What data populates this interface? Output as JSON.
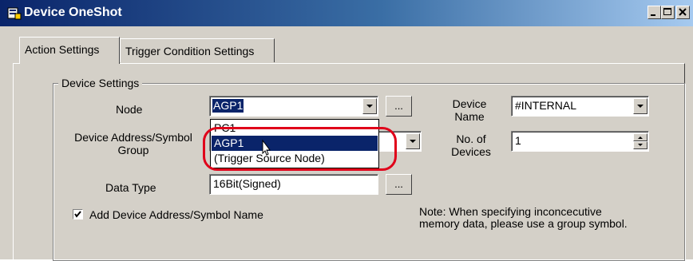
{
  "window": {
    "title": "Device OneShot",
    "icons": {
      "app": "device-oneshot-icon",
      "minimize": "minimize-icon",
      "maximize": "maximize-icon",
      "close": "close-icon"
    }
  },
  "tabs": [
    {
      "label": "Action Settings",
      "active": true
    },
    {
      "label": "Trigger Condition Settings",
      "active": false
    }
  ],
  "device_settings": {
    "group_title": "Device Settings",
    "node": {
      "label": "Node",
      "value": "AGP1",
      "browse_label": "..."
    },
    "node_dropdown": {
      "options": [
        "PC1",
        "AGP1",
        "(Trigger Source Node)"
      ],
      "selected": "AGP1"
    },
    "device_address_group": {
      "label_line1": "Device Address/Symbol",
      "label_line2": "Group"
    },
    "data_type": {
      "label": "Data Type",
      "value": "16Bit(Signed)",
      "browse_label": "..."
    },
    "device_name": {
      "label_line1": "Device",
      "label_line2": "Name",
      "value": "#INTERNAL"
    },
    "no_of_devices": {
      "label_line1": "No. of",
      "label_line2": "Devices",
      "value": "1"
    },
    "add_device_checkbox": {
      "label": "Add Device Address/Symbol Name",
      "checked": true
    },
    "note": "Note: When specifying inconcecutive memory data, please use a group symbol."
  },
  "colors": {
    "title_bar": "#0a246a",
    "selection": "#0a246a",
    "highlight_ring": "#e0001a",
    "face": "#d4d0c8"
  }
}
